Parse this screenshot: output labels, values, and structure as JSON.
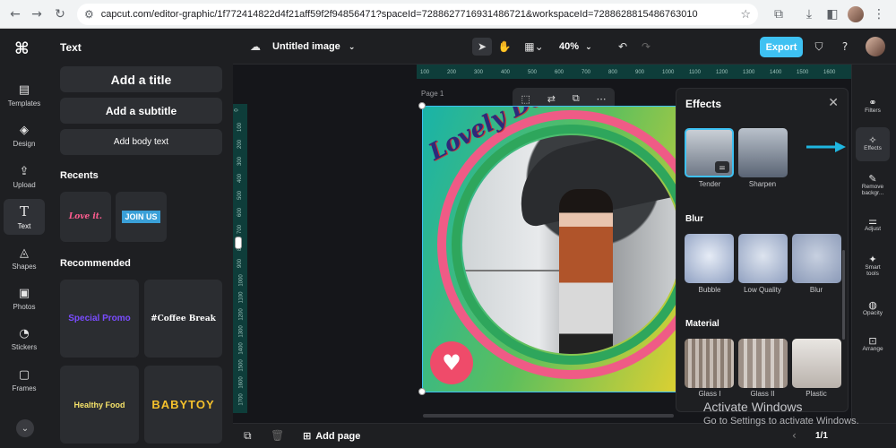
{
  "browser": {
    "url": "capcut.com/editor-graphic/1f772414822d4f21aff59f2f94856471?spaceId=7288627716931486721&workspaceId=7288628815486763010",
    "nav_icons": [
      "back-icon",
      "forward-icon",
      "reload-icon"
    ]
  },
  "rail": {
    "items": [
      {
        "label": "Templates",
        "icon": "▤"
      },
      {
        "label": "Design",
        "icon": "◈"
      },
      {
        "label": "Upload",
        "icon": "⇪"
      },
      {
        "label": "Text",
        "icon": "T"
      },
      {
        "label": "Shapes",
        "icon": "◬"
      },
      {
        "label": "Photos",
        "icon": "▣"
      },
      {
        "label": "Stickers",
        "icon": "◔"
      },
      {
        "label": "Frames",
        "icon": "▢"
      }
    ],
    "active": "Text"
  },
  "panel": {
    "title": "Text",
    "add_title": "Add a title",
    "add_subtitle": "Add a subtitle",
    "add_body": "Add body text",
    "recents_label": "Recents",
    "recents": [
      "Love it.",
      "JOIN US"
    ],
    "recommended_label": "Recommended",
    "recommended": [
      "Special Promo",
      "#Coffee Break",
      "Healthy Food",
      "BABYTOY"
    ]
  },
  "topbar": {
    "title": "Untitled image",
    "zoom": "40%",
    "export_label": "Export"
  },
  "canvas": {
    "page_label": "Page 1",
    "ruler_h": [
      "100",
      "200",
      "300",
      "400",
      "500",
      "600",
      "700",
      "800",
      "900",
      "1000",
      "1100",
      "1200",
      "1300",
      "1400",
      "1500",
      "1600"
    ],
    "ruler_v": [
      "0",
      "100",
      "200",
      "300",
      "400",
      "500",
      "600",
      "700",
      "800",
      "900",
      "1000",
      "1100",
      "1200",
      "1300",
      "1400",
      "1500",
      "1600",
      "1700"
    ],
    "headline": "Lovely Day"
  },
  "effects": {
    "title": "Effects",
    "top": [
      {
        "label": "Tender"
      },
      {
        "label": "Sharpen"
      }
    ],
    "blur_label": "Blur",
    "blur": [
      {
        "label": "Bubble"
      },
      {
        "label": "Low Quality"
      },
      {
        "label": "Blur"
      }
    ],
    "material_label": "Material",
    "material": [
      {
        "label": "Glass I"
      },
      {
        "label": "Glass II"
      },
      {
        "label": "Plastic"
      }
    ]
  },
  "right_sidebar": {
    "items": [
      {
        "label": "Filters",
        "icon": "⚭"
      },
      {
        "label": "Effects",
        "icon": "✧"
      },
      {
        "label": "Remove backgr...",
        "icon": "✎"
      },
      {
        "label": "Adjust",
        "icon": "⚌"
      },
      {
        "label": "Smart tools",
        "icon": "✦"
      },
      {
        "label": "Opacity",
        "icon": "◍"
      },
      {
        "label": "Arrange",
        "icon": "⊡"
      }
    ],
    "active": "Effects"
  },
  "bottom": {
    "add_page": "Add page",
    "pager": "1/1"
  },
  "watermark": {
    "line1": "Activate Windows",
    "line2": "Go to Settings to activate Windows."
  },
  "colors": {
    "accent": "#3ec1f2",
    "bg": "#1a1b1e",
    "panel": "#1e1f22"
  }
}
